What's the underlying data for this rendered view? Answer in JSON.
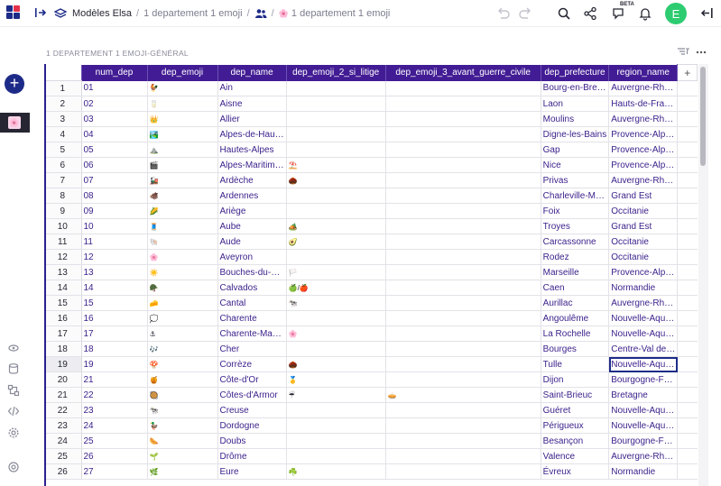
{
  "topbar": {
    "workspace": "Modèles Elsa",
    "doc": "1 departement 1 emoji",
    "page": "1 departement 1 emoji",
    "page_emoji": "🌸",
    "beta": "BETA",
    "avatar": "E",
    "colors": {
      "accent": "#421c94",
      "avatar": "#2ecc71"
    }
  },
  "section": {
    "title": "1 DEPARTEMENT 1 EMOJI-GÉNÉRAL"
  },
  "grid": {
    "columns": [
      "num_dep",
      "dep_emoji",
      "dep_name",
      "dep_emoji_2_si_litige",
      "dep_emoji_3_avant_guerre_civile",
      "dep_prefecture",
      "region_name"
    ],
    "add_column": "+",
    "rows": [
      {
        "n": "1",
        "num": "01",
        "e": "🐓",
        "name": "Ain",
        "e2": "",
        "e3": "",
        "pref": "Bourg-en-Bre…",
        "reg": "Auvergne-Rh…"
      },
      {
        "n": "2",
        "num": "02",
        "e": "🥛",
        "name": "Aisne",
        "e2": "",
        "e3": "",
        "pref": "Laon",
        "reg": "Hauts-de-Fra…"
      },
      {
        "n": "3",
        "num": "03",
        "e": "👑",
        "name": "Allier",
        "e2": "",
        "e3": "",
        "pref": "Moulins",
        "reg": "Auvergne-Rh…"
      },
      {
        "n": "4",
        "num": "04",
        "e": "🏞️",
        "name": "Alpes-de-Hau…",
        "e2": "",
        "e3": "",
        "pref": "Digne-les-Bains",
        "reg": "Provence-Alp…"
      },
      {
        "n": "5",
        "num": "05",
        "e": "⛰️",
        "name": "Hautes-Alpes",
        "e2": "",
        "e3": "",
        "pref": "Gap",
        "reg": "Provence-Alp…"
      },
      {
        "n": "6",
        "num": "06",
        "e": "🎬",
        "name": "Alpes-Maritim…",
        "e2": "⛱️",
        "e3": "",
        "pref": "Nice",
        "reg": "Provence-Alp…"
      },
      {
        "n": "7",
        "num": "07",
        "e": "🚂",
        "name": "Ardèche",
        "e2": "🌰",
        "e3": "",
        "pref": "Privas",
        "reg": "Auvergne-Rh…"
      },
      {
        "n": "8",
        "num": "08",
        "e": "🐗",
        "name": "Ardennes",
        "e2": "",
        "e3": "",
        "pref": "Charleville-M…",
        "reg": "Grand Est"
      },
      {
        "n": "9",
        "num": "09",
        "e": "🌽",
        "name": "Ariège",
        "e2": "",
        "e3": "",
        "pref": "Foix",
        "reg": "Occitanie"
      },
      {
        "n": "10",
        "num": "10",
        "e": "🧵",
        "name": "Aube",
        "e2": "🏕️",
        "e3": "",
        "pref": "Troyes",
        "reg": "Grand Est"
      },
      {
        "n": "11",
        "num": "11",
        "e": "🐚",
        "name": "Aude",
        "e2": "🥑",
        "e3": "",
        "pref": "Carcassonne",
        "reg": "Occitanie"
      },
      {
        "n": "12",
        "num": "12",
        "e": "🌸",
        "name": "Aveyron",
        "e2": "",
        "e3": "",
        "pref": "Rodez",
        "reg": "Occitanie"
      },
      {
        "n": "13",
        "num": "13",
        "e": "☀️",
        "name": "Bouches-du-…",
        "e2": "🏳️",
        "e3": "",
        "pref": "Marseille",
        "reg": "Provence-Alp…"
      },
      {
        "n": "14",
        "num": "14",
        "e": "🪖",
        "name": "Calvados",
        "e2": "🍏/🍎",
        "e3": "",
        "pref": "Caen",
        "reg": "Normandie"
      },
      {
        "n": "15",
        "num": "15",
        "e": "🧀",
        "name": "Cantal",
        "e2": "🐄",
        "e3": "",
        "pref": "Aurillac",
        "reg": "Auvergne-Rh…"
      },
      {
        "n": "16",
        "num": "16",
        "e": "💭",
        "name": "Charente",
        "e2": "",
        "e3": "",
        "pref": "Angoulême",
        "reg": "Nouvelle-Aqu…"
      },
      {
        "n": "17",
        "num": "17",
        "e": "⚓",
        "name": "Charente-Ma…",
        "e2": "🌸",
        "e3": "",
        "pref": "La Rochelle",
        "reg": "Nouvelle-Aqu…"
      },
      {
        "n": "18",
        "num": "18",
        "e": "🎶",
        "name": "Cher",
        "e2": "",
        "e3": "",
        "pref": "Bourges",
        "reg": "Centre-Val de…"
      },
      {
        "n": "19",
        "num": "19",
        "e": "🍄",
        "name": "Corrèze",
        "e2": "🌰",
        "e3": "",
        "pref": "Tulle",
        "reg": "Nouvelle-Aqu…"
      },
      {
        "n": "20",
        "num": "21",
        "e": "🍯",
        "name": "Côte-d'Or",
        "e2": "🥇",
        "e3": "",
        "pref": "Dijon",
        "reg": "Bourgogne-F…"
      },
      {
        "n": "21",
        "num": "22",
        "e": "🥘",
        "name": "Côtes-d'Armor",
        "e2": "☔",
        "e3": "🥧",
        "pref": "Saint-Brieuc",
        "reg": "Bretagne"
      },
      {
        "n": "22",
        "num": "23",
        "e": "🐄",
        "name": "Creuse",
        "e2": "",
        "e3": "",
        "pref": "Guéret",
        "reg": "Nouvelle-Aqu…"
      },
      {
        "n": "23",
        "num": "24",
        "e": "🦆",
        "name": "Dordogne",
        "e2": "",
        "e3": "",
        "pref": "Périgueux",
        "reg": "Nouvelle-Aqu…"
      },
      {
        "n": "24",
        "num": "25",
        "e": "🌭",
        "name": "Doubs",
        "e2": "",
        "e3": "",
        "pref": "Besançon",
        "reg": "Bourgogne-F…"
      },
      {
        "n": "25",
        "num": "26",
        "e": "🌱",
        "name": "Drôme",
        "e2": "",
        "e3": "",
        "pref": "Valence",
        "reg": "Auvergne-Rh…"
      },
      {
        "n": "26",
        "num": "27",
        "e": "🌿",
        "name": "Eure",
        "e2": "☘️",
        "e3": "",
        "pref": "Évreux",
        "reg": "Normandie"
      }
    ]
  }
}
